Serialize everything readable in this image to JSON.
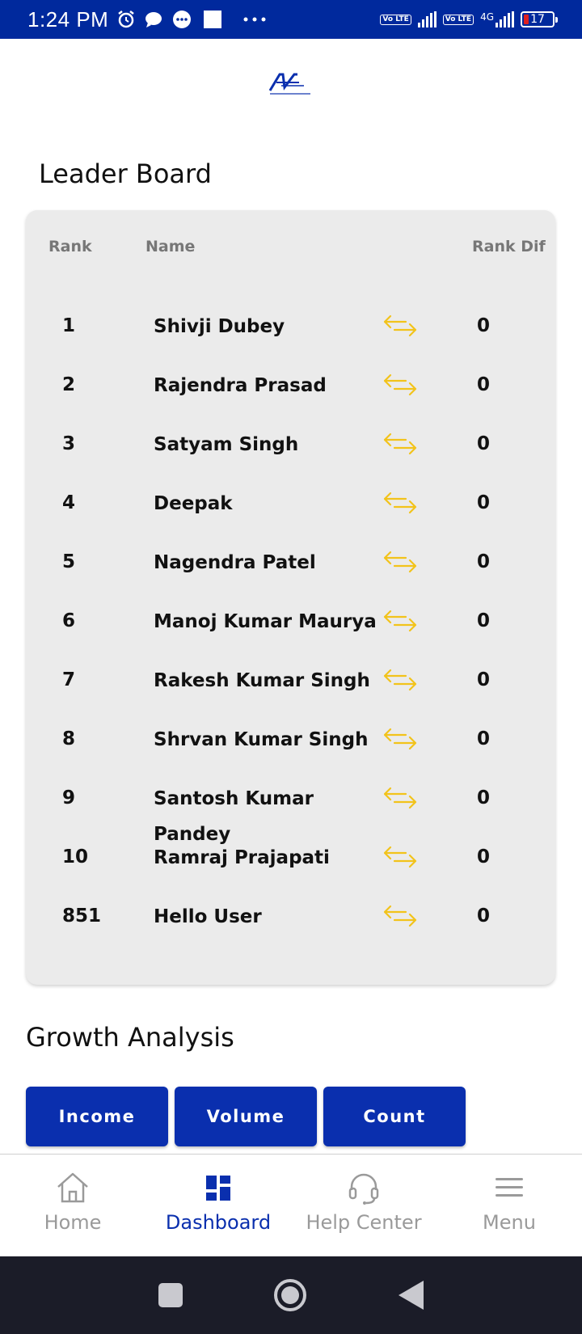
{
  "status_bar": {
    "time": "1:24 PM",
    "battery": "17",
    "network": "4G",
    "volte_label": "Vo LTE",
    "icons": [
      "alarm-icon",
      "chat-icon",
      "message-icon",
      "square-icon",
      "more-icon",
      "signal-icon",
      "battery-icon"
    ]
  },
  "leaderboard": {
    "title": "Leader Board",
    "columns": {
      "rank": "Rank",
      "name": "Name",
      "rank_diff": "Rank Dif"
    },
    "rows": [
      {
        "rank": "1",
        "name": "Shivji Dubey",
        "diff": "0"
      },
      {
        "rank": "2",
        "name": "Rajendra Prasad",
        "diff": "0"
      },
      {
        "rank": "3",
        "name": "Satyam Singh",
        "diff": "0"
      },
      {
        "rank": "4",
        "name": "Deepak",
        "diff": "0"
      },
      {
        "rank": "5",
        "name": "Nagendra Patel",
        "diff": "0"
      },
      {
        "rank": "6",
        "name": "Manoj Kumar Maurya",
        "diff": "0"
      },
      {
        "rank": "7",
        "name": "Rakesh Kumar Singh",
        "diff": "0"
      },
      {
        "rank": "8",
        "name": "Shrvan Kumar Singh",
        "diff": "0"
      },
      {
        "rank": "9",
        "name": "Santosh Kumar Pandey",
        "diff": "0"
      },
      {
        "rank": "10",
        "name": "Ramraj Prajapati",
        "diff": "0"
      },
      {
        "rank": "851",
        "name": "Hello User",
        "diff": "0"
      }
    ],
    "diff_icon": "swap-arrows-icon",
    "diff_icon_color": "#f2c31b"
  },
  "growth": {
    "title": "Growth Analysis",
    "buttons": [
      "Income",
      "Volume",
      "Count"
    ]
  },
  "bottom_nav": [
    {
      "label": "Home",
      "icon": "home-icon",
      "active": false
    },
    {
      "label": "Dashboard",
      "icon": "dashboard-icon",
      "active": true
    },
    {
      "label": "Help Center",
      "icon": "headset-icon",
      "active": false
    },
    {
      "label": "Menu",
      "icon": "menu-icon",
      "active": false
    }
  ],
  "colors": {
    "brand": "#0a2fae",
    "status_bar": "#00299d",
    "accent": "#f2c31b",
    "card_bg": "#ebebeb",
    "system_nav": "#1b1c28"
  }
}
